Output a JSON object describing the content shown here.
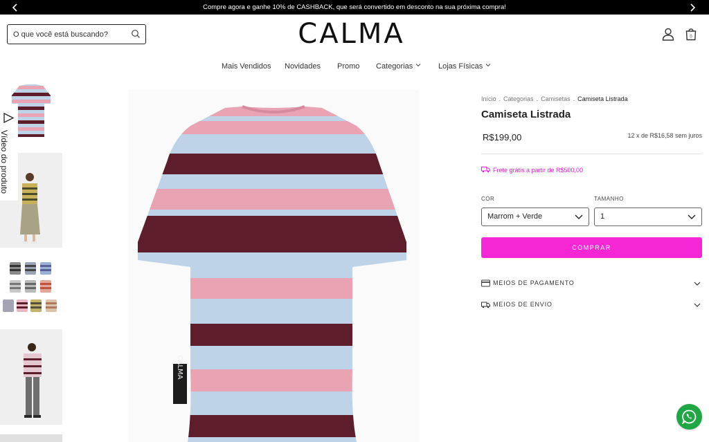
{
  "announcement": {
    "text": "Compre agora e ganhe 10% de CASHBACK, que será convertido em desconto na sua próxima compra!"
  },
  "header": {
    "search_placeholder": "O que você está buscando?",
    "logo": "CALMA"
  },
  "nav": {
    "items": [
      {
        "label": "Mais Vendidos",
        "dropdown": false
      },
      {
        "label": "Novidades",
        "dropdown": false
      },
      {
        "label": "Promo",
        "dropdown": false
      },
      {
        "label": "Categorias",
        "dropdown": true
      },
      {
        "label": "Lojas Físicas",
        "dropdown": true
      }
    ]
  },
  "gallery": {
    "video_label": "Vídeo do produto",
    "main_tag": "CALMA"
  },
  "breadcrumb": {
    "items": [
      "Início",
      "Categorias",
      "Camisetas"
    ],
    "current": "Camiseta Listrada",
    "separator": "."
  },
  "product": {
    "title": "Camiseta Listrada",
    "price": "R$199,00",
    "installments": "12 x de R$16,58 sem juros",
    "shipping_note": "Frete grátis a partir de R$500,00"
  },
  "options": {
    "color_label": "COR",
    "color_value": "Marrom + Verde",
    "size_label": "TAMANHO",
    "size_value": "1"
  },
  "buy_button": "COMPRAR",
  "accordion": {
    "payment": "MEIOS DE PAGAMENTO",
    "shipping": "MEIOS DE ENVIO"
  },
  "colors": {
    "accent": "#f527d4",
    "shipping_text": "#e61bd3",
    "whatsapp": "#1fa745",
    "stripe_pink": "#e9a3b3",
    "stripe_blue": "#bfd3e8",
    "stripe_maroon": "#5e1d2b"
  },
  "icons": {
    "search": "search-icon",
    "user": "user-icon",
    "bag": "shopping-bag-icon",
    "truck": "truck-icon",
    "card": "credit-card-icon",
    "whatsapp": "whatsapp-icon",
    "video": "play-icon"
  }
}
